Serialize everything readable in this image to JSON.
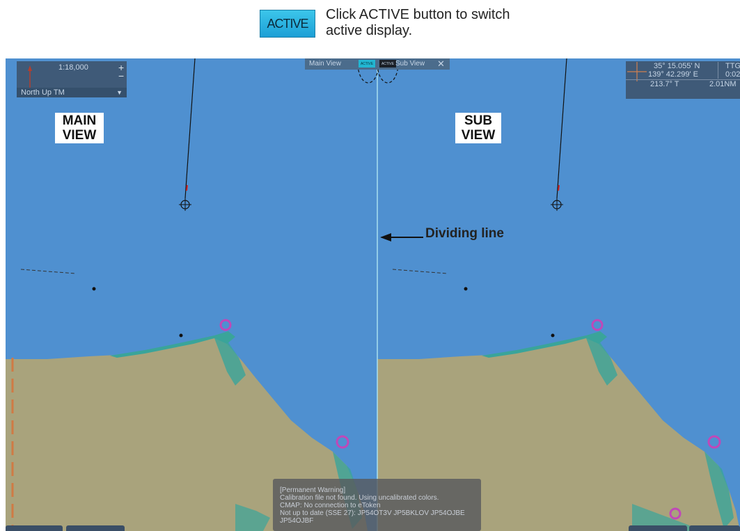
{
  "caption": {
    "button_label": "ACTIVE",
    "text": "Click ACTIVE button to switch active display."
  },
  "tabs": {
    "main_view": "Main View",
    "sub_view": "Sub View",
    "main_active_label": "ACTIVE",
    "sub_active_label": "ACTIVE",
    "close_icon": "close-icon"
  },
  "scale_panel": {
    "scale": "1:18,000",
    "zoom_in": "+",
    "zoom_out": "−",
    "mode": "North Up TM"
  },
  "position_panel": {
    "lat": "35° 15.055' N",
    "lon": "139° 42.299' E",
    "ttg_label": "TTG",
    "ttg_value": "0:02",
    "bearing": "213.7° T",
    "range": "2.01NM"
  },
  "annotations": {
    "main_view_label": "MAIN VIEW",
    "sub_view_label": "SUB VIEW",
    "dividing_line": "Dividing line"
  },
  "warning": {
    "title": "[Permanent Warning]",
    "lines": [
      "Calibration file not found. Using uncalibrated colors.",
      "CMAP: No connection to eToken",
      "Not up to date (SSE 27): JP54OT3V JP5BKLOV JP54OJBE",
      "JP54OJBF"
    ]
  },
  "colors": {
    "sea": "#4f90d0",
    "land": "#a9a37c",
    "shallow": "#3aa49a",
    "panel": "#3f5a78",
    "active_tab": "#22b6d2",
    "divider": "#a8dff0"
  }
}
